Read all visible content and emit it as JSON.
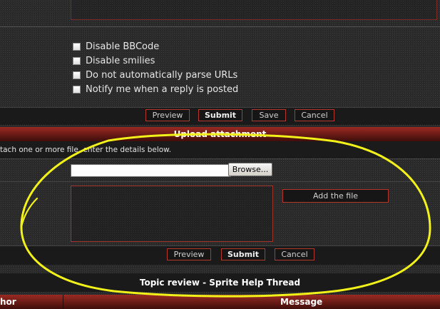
{
  "options": [
    {
      "label": "Disable BBCode",
      "checked": false
    },
    {
      "label": "Disable smilies",
      "checked": false
    },
    {
      "label": "Do not automatically parse URLs",
      "checked": false
    },
    {
      "label": "Notify me when a reply is posted",
      "checked": false
    }
  ],
  "post_buttons": {
    "preview": "Preview",
    "submit": "Submit",
    "save": "Save",
    "cancel": "Cancel"
  },
  "upload": {
    "header": "Upload attachment",
    "description": "tach one or more file, enter the details below.",
    "browse": "Browse...",
    "file_value": "",
    "comment_value": "",
    "add_file": "Add the file"
  },
  "upload_buttons": {
    "preview": "Preview",
    "submit": "Submit",
    "cancel": "Cancel"
  },
  "topic_review": {
    "title": "Topic review - Sprite Help Thread",
    "col_author": "hor",
    "col_message": "Message"
  },
  "colors": {
    "accent_red": "#b2372c",
    "annotation": "#f2f21a"
  }
}
